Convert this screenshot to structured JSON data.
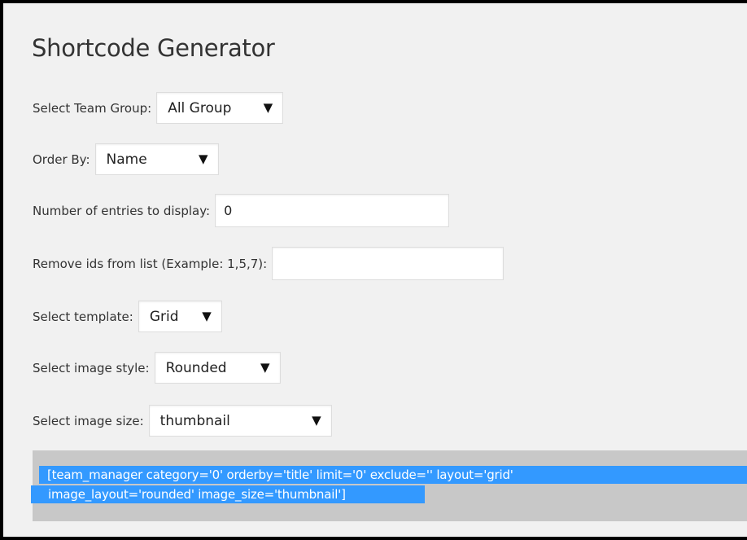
{
  "title": "Shortcode Generator",
  "fields": {
    "team_group": {
      "label": "Select Team Group:",
      "value": "All Group"
    },
    "order_by": {
      "label": "Order By:",
      "value": "Name"
    },
    "entries": {
      "label": "Number of entries to display:",
      "value": "0"
    },
    "remove_ids": {
      "label": "Remove ids from list (Example: 1,5,7):",
      "value": ""
    },
    "template": {
      "label": "Select template:",
      "value": "Grid"
    },
    "image_style": {
      "label": "Select image style:",
      "value": "Rounded"
    },
    "image_size": {
      "label": "Select image size:",
      "value": "thumbnail"
    }
  },
  "dropdown_arrow": "▼",
  "shortcode": {
    "line1": "[team_manager category='0' orderby='title' limit='0' exclude='' layout='grid'",
    "line2": "image_layout='rounded' image_size='thumbnail']"
  },
  "colors": {
    "background": "#f1f1f1",
    "selection": "#3399ff",
    "shortcode_box": "#c8c8c8"
  }
}
